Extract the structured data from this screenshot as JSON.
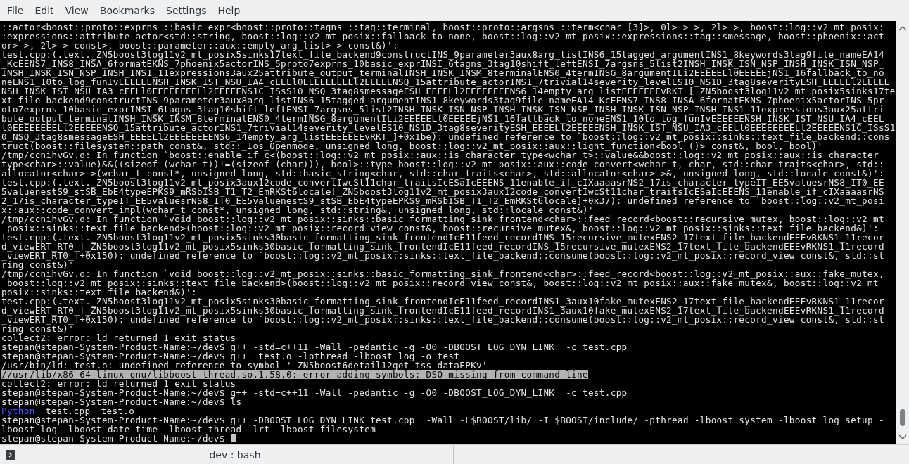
{
  "menu_bar": {
    "items": [
      "File",
      "Edit",
      "View",
      "Bookmarks",
      "Settings",
      "Help"
    ]
  },
  "terminal": {
    "lines": [
      {
        "text": "::actor<boost::proto::exprns_::basic_expr<boost::proto::tagns_::tag::terminal, boost::proto::argsns_::term<char [3]>, 0l> > >, 2l> >, boost::log::v2_mt_posix:",
        "selected": false,
        "cursor": false
      },
      {
        "text": ":expressions::attribute_actor<std::string, boost::log::v2_mt_posix::fallback_to_none, boost::log::v2_mt_posix::expressions::tag::smessage, boost::phoenix::act",
        "selected": false,
        "cursor": false
      },
      {
        "text": "or> >, 2l> > const>, boost::parameter::aux::empty_arg_list> > const&)':",
        "selected": false,
        "cursor": false
      },
      {
        "text": "test.cpp:(.text._ZN5boost3log11v2_mt_posix5sinks17text_file_backend9constructINS_9parameter3aux8arg_listINS6_15tagged_argumentINS1_8keywords3tag9file_nameEA14",
        "selected": false,
        "cursor": false
      },
      {
        "text": "_KcEENS7_INS8_INSA_6formatEKNS_7phoenix5actorINS_5proto7exprns_10basic_exprINSI_6tagns_3tag10shift_leftENSI_7argsns_5list2INSH_INSK_ISN_NSP_INSH_INSK_ISN_NSP_",
        "selected": false,
        "cursor": false
      },
      {
        "text": "INSH_INSK_ISN_NSP_INSH_INS1_11expressions3aux25attribute_output_terminalINSH_INSK_INSM_8terminalENS0_4termINSG_8argumentILi2EEEEELl0EEEEEjNS1_16fallback_to_no",
        "selected": false,
        "cursor": false
      },
      {
        "text": "neENS1_10to_log_funIvEEEEEENSH_INSK_IST_NSU_IA4_cEELl0EEEEEEEELl2EEEEENSQ_15attribute_actorINS1_7trivial14severity_levelES10_NS1D_3tag8severityESH_EEEELl2EEEEE",
        "selected": false,
        "cursor": false
      },
      {
        "text": "NSH_INSK_IST_NSU_IA3_cEELl0EEEEEEEELl2EEEEENS1C_ISsS10_NSQ_3tag8smessageESH_EEEELl2EEEEEEEENS6_14empty_arg_listEEEEEEEvRKT_[_ZN5boost3log11v2_mt_posix5sinks17te",
        "selected": false,
        "cursor": false
      },
      {
        "text": "xt_file_backend9constructINS_9parameter3aux8arg_listINS6_15tagged_argumentINS1_8keywords3tag9file_nameEA14_KcEENS7_INS8_INSA_6formatEKNS_7phoenix5actorINS_5pr",
        "selected": false,
        "cursor": false
      },
      {
        "text": "oto7exprns_10basic_exprINSI_6tagns_3tag10shift_leftENSI_7argsns_5list2INSH_INSK_ISN_NSP_INSH_INSK_ISN_NSP_INSH_INSK_ISN_NSP_INSH_INS1_11expressions3aux25attri",
        "selected": false,
        "cursor": false
      },
      {
        "text": "bute_output_terminalINSH_INSK_INSM_8terminalENS0_4termINSG_8argumentILi2EEEEELl0EEEEEjNS1_16fallback_to_noneENS1_10to_log_funIvEEEEEENSH_INSK_IST_NSU_IA4_cEEL",
        "selected": false,
        "cursor": false
      },
      {
        "text": "l0EEEEEEEELl2EEEEENSQ_15attribute_actorINS1_7trivial14severity_levelES10_NS1D_3tag8severityESH_EEEELl2EEEEENSH_INSK_IST_NSU_IA3_cEELl0EEEEEEEELl2EEEEENS1C_ISsS1",
        "selected": false,
        "cursor": false
      },
      {
        "text": "0_NSQ_3tag8smessageESH_EEEELl2EEEEEEEENS6_14empty_arg_listEEEEEEEvRKT_]+0x1be): undefined reference to `boost::log::v2_mt_posix::sinks::text_file_backend::cons",
        "selected": false,
        "cursor": false
      },
      {
        "text": "truct(boost::filesystem::path const&, std::_Ios_Openmode, unsigned long, boost::log::v2_mt_posix::aux::light_function<bool ()> const&, bool, bool)'",
        "selected": false,
        "cursor": false
      },
      {
        "text": "/tmp/ccnihvGv.o: In function `boost::enable_if_c<(boost::log::v2_mt_posix::aux::is_character_type<wchar_t>::value&&boost::log::v2_mt_posix::aux::is_character_",
        "selected": false,
        "cursor": false
      },
      {
        "text": "type<char>::value)&&((sizeof (wchar_t))!=(sizeof (char))), bool>::type boost::log::v2_mt_posix::aux::code_convert<wchar_t, char, std::char_traits<char>, std::",
        "selected": false,
        "cursor": false
      },
      {
        "text": "allocator<char> >(wchar_t const*, unsigned long, std::basic_string<char, std::char_traits<char>, std::allocator<char> >&, unsigned long, std::locale const&)':",
        "selected": false,
        "cursor": false
      },
      {
        "text": "test.cpp:(.text._ZN5boost3log11v2_mt_posix3aux12code_convertIwcSt11char_traitsIcESaIcEEENS_11enable_if_cIXaaaasrNS2_17is_character_typeIT_EE5valuesrNS8_IT0_EE",
        "selected": false,
        "cursor": false
      },
      {
        "text": "5valuenestS9_stSB_EbE4typeEPKS9_mRSbISB_T1_T2_EmRKSt6locale[_ZN5boost3log11v2_mt_posix3aux12code_convertIwcSt11char_traitsIcESaIcEEENS_11enable_if_cIXaaaasrNS",
        "selected": false,
        "cursor": false
      },
      {
        "text": "2_17is_character_typeIT_EE5valuesrNS8_IT0_EE5valuenestS9_stSB_EbE4typeEPKS9_mRSbISB_T1_T2_EmRKSt6locale]+0x37): undefined reference to `boost::log::v2_mt_posi",
        "selected": false,
        "cursor": false
      },
      {
        "text": "x::aux::code_convert_impl(wchar_t const*, unsigned long, std::string&, unsigned long, std::locale const&)'",
        "selected": false,
        "cursor": false
      },
      {
        "text": "/tmp/ccnihvGv.o: In function `void boost::log::v2_mt_posix::sinks::basic_formatting_sink_frontend<char>::feed_record<boost::recursive_mutex, boost::log::v2_mt",
        "selected": false,
        "cursor": false
      },
      {
        "text": "_posix::sinks::text_file_backend>(boost::log::v2_mt_posix::record_view const&, boost::recursive_mutex&, boost::log::v2_mt_posix::sinks::text_file_backend&)':",
        "selected": false,
        "cursor": false
      },
      {
        "text": "test.cpp:(.text._ZN5boost3log11v2_mt_posix5sinks30basic_formatting_sink_frontendIcE11feed_recordINS_15recursive_mutexENS2_17text_file_backendEEEvRKNS1_11recor",
        "selected": false,
        "cursor": false
      },
      {
        "text": "d_viewERT_RT0_[_ZN5boost3log11v2_mt_posix5sinks30basic_formatting_sink_frontendIcE11feed_recordINS_15recursive_mutexENS2_17text_file_backendEEEvRKNS1_11record",
        "selected": false,
        "cursor": false
      },
      {
        "text": "_viewERT_RT0_]+0x150): undefined reference to `boost::log::v2_mt_posix::sinks::text_file_backend::consume(boost::log::v2_mt_posix::record_view const&, std::st",
        "selected": false,
        "cursor": false
      },
      {
        "text": "ring const&)'",
        "selected": false,
        "cursor": false
      },
      {
        "text": "/tmp/ccnihvGv.o: In function `void boost::log::v2_mt_posix::sinks::basic_formatting_sink_frontend<char>::feed_record<boost::log::v2_mt_posix::aux::fake_mutex,",
        "selected": false,
        "cursor": false
      },
      {
        "text": " boost::log::v2_mt_posix::sinks::text_file_backend>(boost::log::v2_mt_posix::record_view const&, boost::log::v2_mt_posix::aux::fake_mutex&, boost::log::v2_mt_",
        "selected": false,
        "cursor": false
      },
      {
        "text": "posix::sinks::text_file_backend&)':",
        "selected": false,
        "cursor": false
      },
      {
        "text": "test.cpp:(.text._ZN5boost3log11v2_mt_posix5sinks30basic_formatting_sink_frontendIcE11feed_recordINS1_3aux10fake_mutexENS2_17text_file_backendEEEvRKNS1_11recor",
        "selected": false,
        "cursor": false
      },
      {
        "text": "d_viewERT_RT0_[_ZN5boost3log11v2_mt_posix5sinks30basic_formatting_sink_frontendIcE11feed_recordINS1_3aux10fake_mutexENS2_17text_file_backendEEEvRKNS1_11record",
        "selected": false,
        "cursor": false
      },
      {
        "text": "_viewERT_RT0_]+0x150): undefined reference to `boost::log::v2_mt_posix::sinks::text_file_backend::consume(boost::log::v2_mt_posix::record_view const&, std::st",
        "selected": false,
        "cursor": false
      },
      {
        "text": "ring const&)'",
        "selected": false,
        "cursor": false
      },
      {
        "text": "collect2: error: ld returned 1 exit status",
        "selected": false,
        "cursor": false
      },
      {
        "text": "stepan@stepan-System-Product-Name:~/dev$ g++ -std=c++11 -Wall -pedantic -g -O0 -DBOOST_LOG_DYN_LINK  -c test.cpp",
        "selected": false,
        "cursor": false
      },
      {
        "text": "stepan@stepan-System-Product-Name:~/dev$ g++  test.o -lpthread -lboost_log -o test",
        "selected": false,
        "cursor": false
      },
      {
        "text": "/usr/bin/ld: test.o: undefined reference to symbol '_ZN5boost6detail12get_tss_dataEPKv'",
        "selected": false,
        "cursor": false
      },
      {
        "text": "//usr/lib/x86_64-linux-gnu/libboost_thread.so.1.58.0: error adding symbols: DSO missing from command line",
        "selected": true,
        "cursor": false
      },
      {
        "text": "collect2: error: ld returned 1 exit status",
        "selected": false,
        "cursor": false
      },
      {
        "text": "stepan@stepan-System-Product-Name:~/dev$ g++ -std=c++11 -Wall -pedantic -g -O0 -DBOOST_LOG_DYN_LINK  -c test.cpp",
        "selected": false,
        "cursor": false
      },
      {
        "text": "stepan@stepan-System-Product-Name:~/dev$ ls",
        "selected": false,
        "cursor": false
      },
      {
        "kind": "listing",
        "entries": [
          {
            "text": "Python",
            "kind": "directory"
          },
          {
            "text": "test.cpp",
            "kind": "file"
          },
          {
            "text": "test.o",
            "kind": "file"
          }
        ],
        "selected": false,
        "cursor": false
      },
      {
        "text": "stepan@stepan-System-Product-Name:~/dev$ g++ -DBOOST_LOG_DYN_LINK test.cpp  -Wall -L$BOOST/lib/ -I $BOOST/include/ -pthread -lboost_system -lboost_log_setup -",
        "selected": false,
        "cursor": false
      },
      {
        "text": "lboost_log -lboost_date_time -lboost_thread -lrt -lboost_filesystem",
        "selected": false,
        "cursor": false
      },
      {
        "text": "stepan@stepan-System-Product-Name:~/dev$",
        "selected": false,
        "cursor": true
      }
    ]
  },
  "tab_bar": {
    "tabs": [
      {
        "label": "dev : bash",
        "selected": true
      }
    ]
  }
}
